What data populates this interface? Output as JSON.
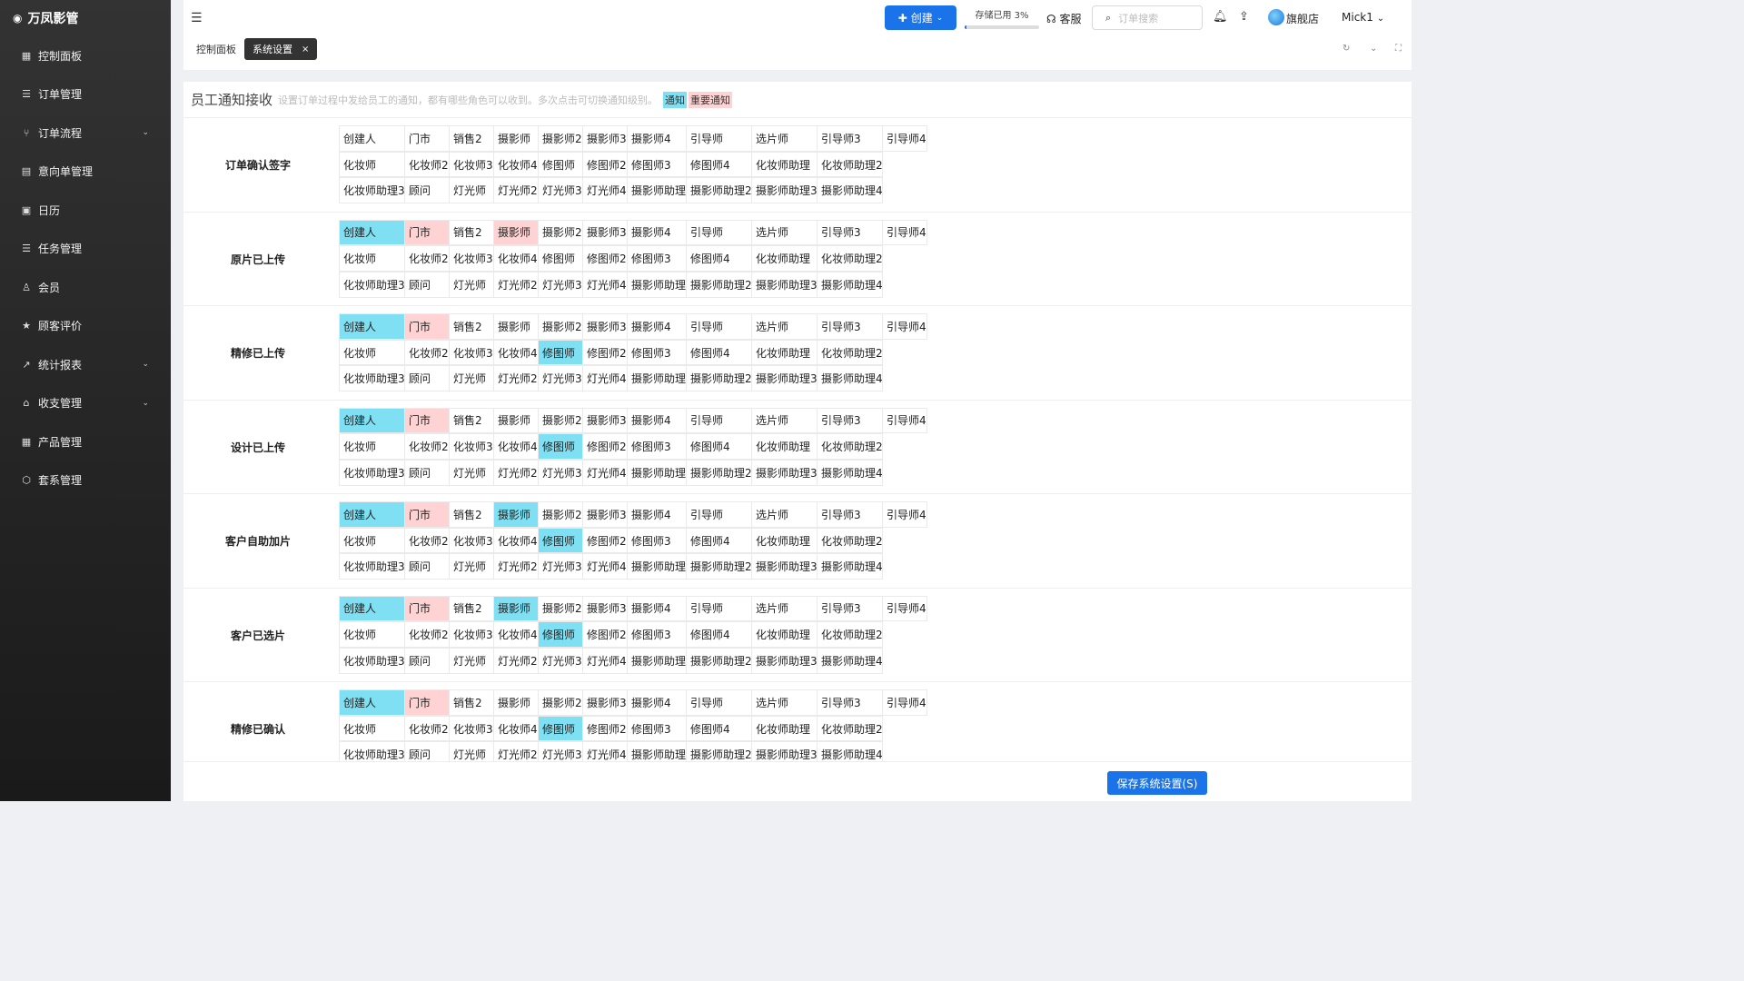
{
  "app": {
    "title": "万凤影管"
  },
  "sidebar": {
    "items": [
      {
        "label": "控制面板",
        "icon": "grid-icon",
        "glyph": "▦",
        "chevron": false
      },
      {
        "label": "订单管理",
        "icon": "list-icon",
        "glyph": "☰",
        "chevron": false
      },
      {
        "label": "订单流程",
        "icon": "flow-icon",
        "glyph": "⑂",
        "chevron": true
      },
      {
        "label": "意向单管理",
        "icon": "document-icon",
        "glyph": "▤",
        "chevron": false
      },
      {
        "label": "日历",
        "icon": "calendar-icon",
        "glyph": "▣",
        "chevron": false
      },
      {
        "label": "任务管理",
        "icon": "tasks-icon",
        "glyph": "☰",
        "chevron": false
      },
      {
        "label": "会员",
        "icon": "user-icon",
        "glyph": "♙",
        "chevron": false
      },
      {
        "label": "顾客评价",
        "icon": "star-icon",
        "glyph": "★",
        "chevron": false
      },
      {
        "label": "统计报表",
        "icon": "chart-icon",
        "glyph": "↗",
        "chevron": true
      },
      {
        "label": "收支管理",
        "icon": "bank-icon",
        "glyph": "⌂",
        "chevron": true
      },
      {
        "label": "产品管理",
        "icon": "apps-icon",
        "glyph": "▦",
        "chevron": false
      },
      {
        "label": "套系管理",
        "icon": "package-icon",
        "glyph": "⬡",
        "chevron": false
      }
    ]
  },
  "topbar": {
    "create_label": "创建",
    "storage_label": "存储已用 3%",
    "storage_percent": 3,
    "support_label": "客服",
    "search_placeholder": "订单搜索",
    "store_label": "旗舰店",
    "user_label": "Mick1"
  },
  "tabs": {
    "dashboard": "控制面板",
    "system_settings": "系统设置"
  },
  "section": {
    "title": "员工通知接收",
    "description": "设置订单过程中发给员工的通知，都有哪些角色可以收到。多次点击可切换通知级别。",
    "legend_notify": "通知",
    "legend_important": "重要通知"
  },
  "colors": {
    "notify": "#7ee0f2",
    "important": "#ffd3d3",
    "accent": "#1a73e8"
  },
  "roles": [
    [
      "创建人",
      "门市",
      "销售2",
      "摄影师",
      "摄影师2",
      "摄影师3",
      "摄影师4",
      "引导师",
      "选片师",
      "引导师3",
      "引导师4"
    ],
    [
      "化妆师",
      "化妆师2",
      "化妆师3",
      "化妆师4",
      "修图师",
      "修图师2",
      "修图师3",
      "修图师4",
      "化妆师助理",
      "化妆师助理2"
    ],
    [
      "化妆师助理3",
      "顾问",
      "灯光师",
      "灯光师2",
      "灯光师3",
      "灯光师4",
      "摄影师助理",
      "摄影师助理2",
      "摄影师助理3",
      "摄影师助理4"
    ]
  ],
  "events": [
    {
      "name": "订单确认签字",
      "notify": [],
      "important": []
    },
    {
      "name": "原片已上传",
      "notify": [
        "0-0"
      ],
      "important": [
        "0-1",
        "0-3"
      ]
    },
    {
      "name": "精修已上传",
      "notify": [
        "0-0",
        "1-4"
      ],
      "important": [
        "0-1"
      ]
    },
    {
      "name": "设计已上传",
      "notify": [
        "0-0",
        "1-4"
      ],
      "important": [
        "0-1"
      ]
    },
    {
      "name": "客户自助加片",
      "notify": [
        "0-0",
        "0-3",
        "1-4"
      ],
      "important": [
        "0-1"
      ]
    },
    {
      "name": "客户已选片",
      "notify": [
        "0-0",
        "0-3",
        "1-4"
      ],
      "important": [
        "0-1"
      ]
    },
    {
      "name": "精修已确认",
      "notify": [
        "0-0",
        "1-4"
      ],
      "important": [
        "0-1"
      ]
    }
  ],
  "footer": {
    "save_label": "保存系统设置(S)"
  }
}
